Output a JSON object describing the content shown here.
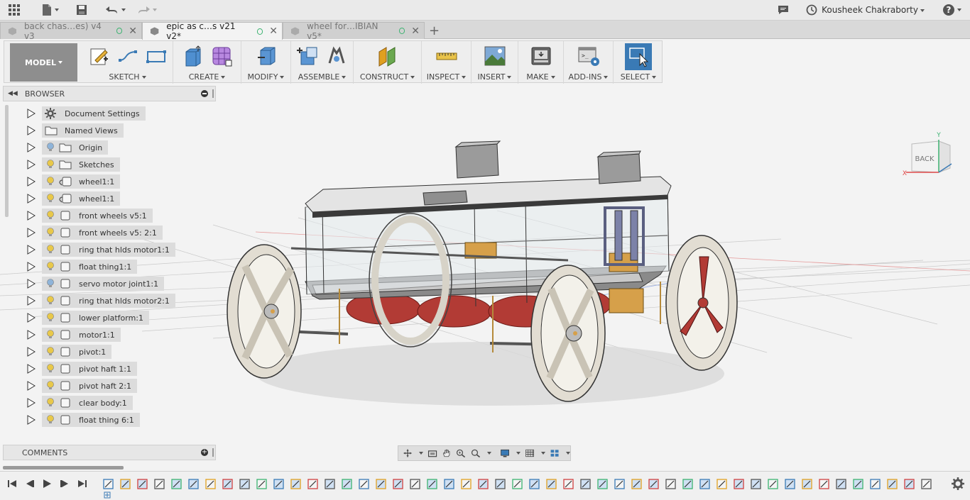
{
  "appbar": {
    "user_name": "Kousheek Chakraborty",
    "help_label": "?"
  },
  "tabs": [
    {
      "label": "back chas…es) v4 v3",
      "active": false
    },
    {
      "label": "epic as c…s v21 v2*",
      "active": true
    },
    {
      "label": "wheel for…IBIAN v5*",
      "active": false
    }
  ],
  "toolbar": {
    "model_label": "MODEL",
    "groups": [
      "SKETCH",
      "CREATE",
      "MODIFY",
      "ASSEMBLE",
      "CONSTRUCT",
      "INSPECT",
      "INSERT",
      "MAKE",
      "ADD-INS",
      "SELECT"
    ]
  },
  "browser": {
    "title": "BROWSER",
    "items": [
      {
        "label": "Document Settings",
        "icon": "gear-icon",
        "bulb": false
      },
      {
        "label": "Named Views",
        "icon": "folder-icon",
        "bulb": false
      },
      {
        "label": "Origin",
        "icon": "folder-icon",
        "bulb": "off"
      },
      {
        "label": "Sketches",
        "icon": "folder-icon",
        "bulb": "on"
      },
      {
        "label": "wheel1:1",
        "icon": "linked-component-icon",
        "bulb": "on"
      },
      {
        "label": "wheel1:1",
        "icon": "linked-component-icon",
        "bulb": "on"
      },
      {
        "label": "front wheels v5:1",
        "icon": "component-icon",
        "bulb": "on"
      },
      {
        "label": "front wheels v5: 2:1",
        "icon": "component-icon",
        "bulb": "on"
      },
      {
        "label": "ring that hlds motor1:1",
        "icon": "component-icon",
        "bulb": "on"
      },
      {
        "label": "float thing1:1",
        "icon": "component-icon",
        "bulb": "on"
      },
      {
        "label": "servo motor joint1:1",
        "icon": "component-icon",
        "bulb": "off"
      },
      {
        "label": "ring that hlds motor2:1",
        "icon": "component-icon",
        "bulb": "on"
      },
      {
        "label": "lower platform:1",
        "icon": "component-icon",
        "bulb": "on"
      },
      {
        "label": "motor1:1",
        "icon": "component-icon",
        "bulb": "on"
      },
      {
        "label": "pivot:1",
        "icon": "component-icon",
        "bulb": "on"
      },
      {
        "label": "pivot haft 1:1",
        "icon": "component-icon",
        "bulb": "on"
      },
      {
        "label": "pivot haft 2:1",
        "icon": "component-icon",
        "bulb": "on"
      },
      {
        "label": "clear body:1",
        "icon": "component-icon",
        "bulb": "on"
      },
      {
        "label": "float thing 6:1",
        "icon": "component-icon",
        "bulb": "on"
      }
    ]
  },
  "comments": {
    "title": "COMMENTS"
  },
  "viewcube": {
    "face_label": "BACK",
    "axis_x": "X",
    "axis_y": "Y"
  },
  "colors": {
    "accent_select": "#3a7ab5",
    "bulb_on": "#e8c84a",
    "bulb_off": "#8fb4d9"
  }
}
